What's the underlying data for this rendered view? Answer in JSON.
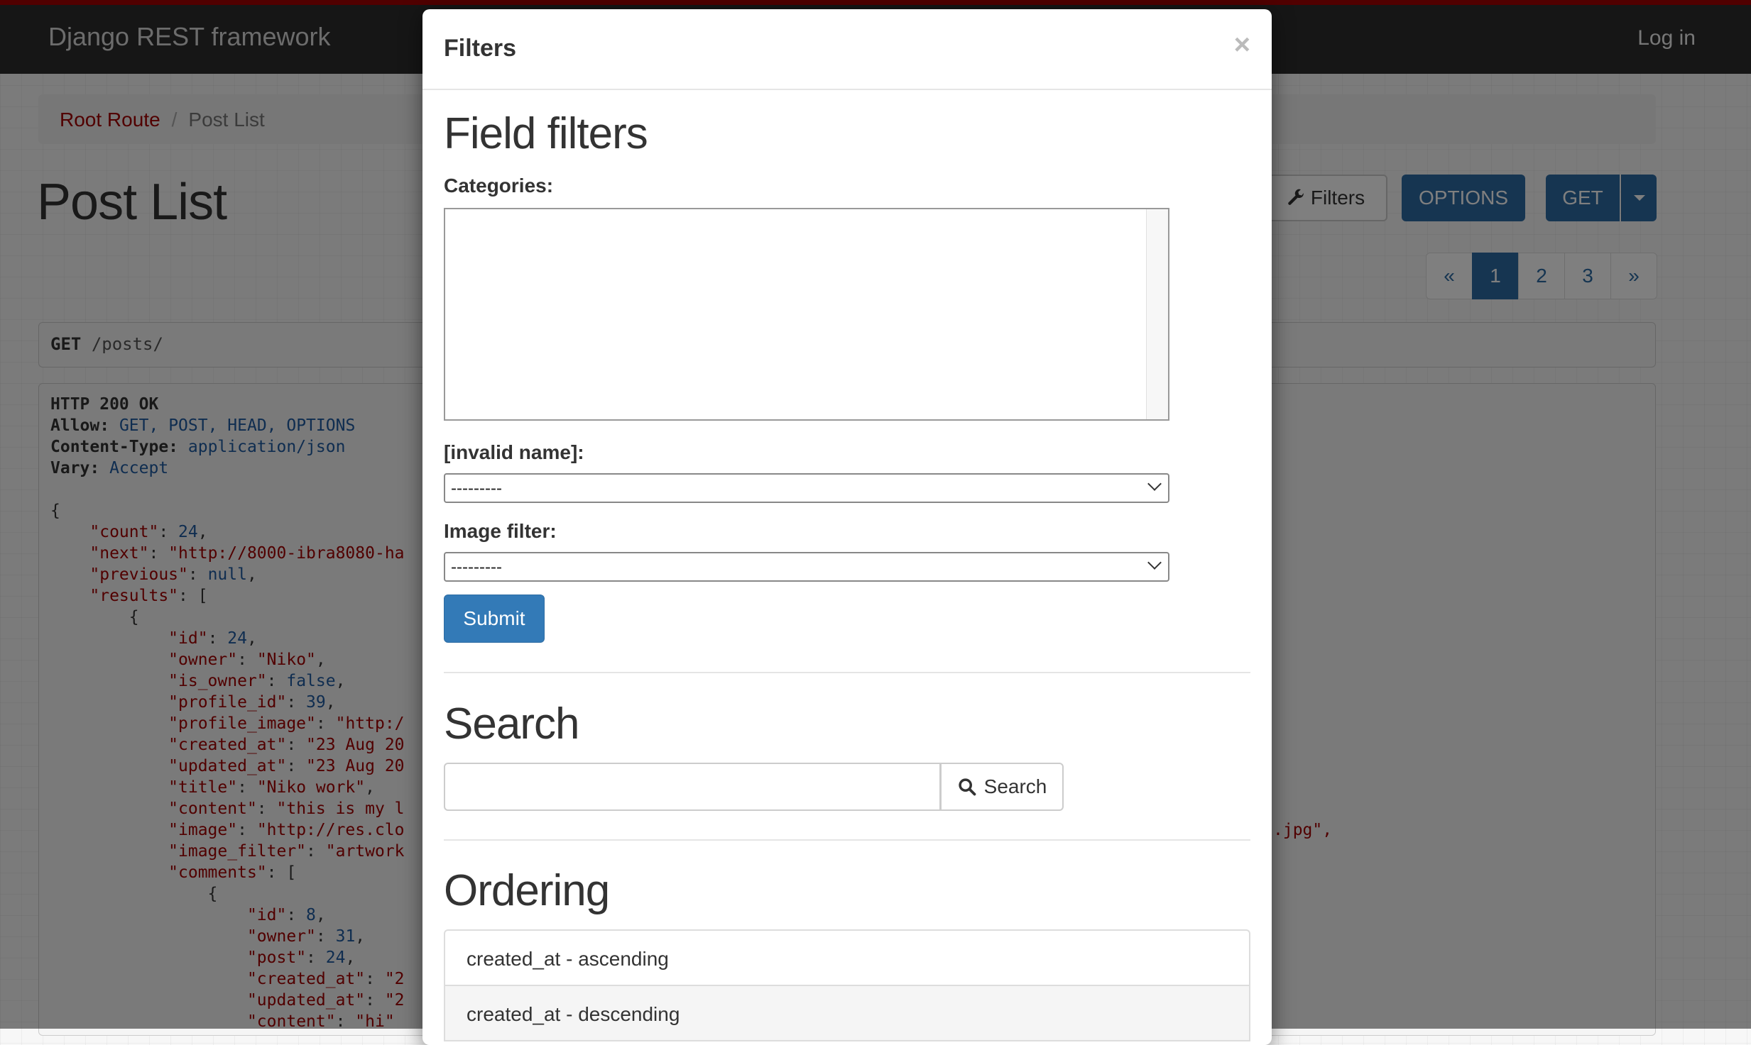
{
  "navbar": {
    "brand": "Django REST framework",
    "login": "Log in"
  },
  "breadcrumb": {
    "root": "Root Route",
    "separator": "/",
    "current": "Post List"
  },
  "page": {
    "title": "Post List"
  },
  "toolbar": {
    "filters_label": "Filters",
    "options_label": "OPTIONS",
    "get_label": "GET"
  },
  "pagination": {
    "prev": "«",
    "pages": [
      "1",
      "2",
      "3"
    ],
    "next": "»",
    "active": "1"
  },
  "request": {
    "method": "GET",
    "path": "/posts/"
  },
  "response": {
    "status": "HTTP 200 OK",
    "headers": [
      {
        "name": "Allow:",
        "value": "GET, POST, HEAD, OPTIONS"
      },
      {
        "name": "Content-Type:",
        "value": "application/json"
      },
      {
        "name": "Vary:",
        "value": "Accept"
      }
    ],
    "body_lines": [
      [
        "{"
      ],
      [
        "    ",
        "\"count\"",
        ": ",
        "24",
        ","
      ],
      [
        "    ",
        "\"next\"",
        ": ",
        "\"http://8000-ibra8080-ha",
        ""
      ],
      [
        "    ",
        "\"previous\"",
        ": ",
        "null",
        ","
      ],
      [
        "    ",
        "\"results\"",
        ": ",
        "[",
        ""
      ],
      [
        "        {"
      ],
      [
        "            ",
        "\"id\"",
        ": ",
        "24",
        ","
      ],
      [
        "            ",
        "\"owner\"",
        ": ",
        "\"Niko\"",
        ","
      ],
      [
        "            ",
        "\"is_owner\"",
        ": ",
        "false",
        ","
      ],
      [
        "            ",
        "\"profile_id\"",
        ": ",
        "39",
        ","
      ],
      [
        "            ",
        "\"profile_image\"",
        ": ",
        "\"http:/",
        ""
      ],
      [
        "            ",
        "\"created_at\"",
        ": ",
        "\"23 Aug 20",
        ""
      ],
      [
        "            ",
        "\"updated_at\"",
        ": ",
        "\"23 Aug 20",
        ""
      ],
      [
        "            ",
        "\"title\"",
        ": ",
        "\"Niko work\"",
        ","
      ],
      [
        "            ",
        "\"content\"",
        ": ",
        "\"this is my l",
        ""
      ],
      [
        "            ",
        "\"image\"",
        ": ",
        "\"http://res.clo",
        ""
      ],
      [
        "            ",
        "\"image_filter\"",
        ": ",
        "\"artwork",
        ""
      ],
      [
        "            ",
        "\"comments\"",
        ": ",
        "[",
        ""
      ],
      [
        "                {"
      ],
      [
        "                    ",
        "\"id\"",
        ": ",
        "8",
        ","
      ],
      [
        "                    ",
        "\"owner\"",
        ": ",
        "31",
        ","
      ],
      [
        "                    ",
        "\"post\"",
        ": ",
        "24",
        ","
      ],
      [
        "                    ",
        "\"created_at\"",
        ": ",
        "\"2",
        ""
      ],
      [
        "                    ",
        "\"updated_at\"",
        ": ",
        "\"2",
        ""
      ],
      [
        "                    ",
        "\"content\"",
        ": ",
        "\"hi\"",
        ""
      ]
    ],
    "image_suffix": ".jpg\","
  },
  "modal": {
    "title": "Filters",
    "close": "×",
    "field_filters": {
      "heading": "Field filters",
      "categories_label": "Categories:",
      "invalid_name_label": "[invalid name]:",
      "invalid_name_value": "---------",
      "image_filter_label": "Image filter:",
      "image_filter_value": "---------",
      "submit_label": "Submit"
    },
    "search": {
      "heading": "Search",
      "input_value": "",
      "button_label": "Search"
    },
    "ordering": {
      "heading": "Ordering",
      "options": [
        "created_at - ascending",
        "created_at - descending"
      ]
    }
  }
}
